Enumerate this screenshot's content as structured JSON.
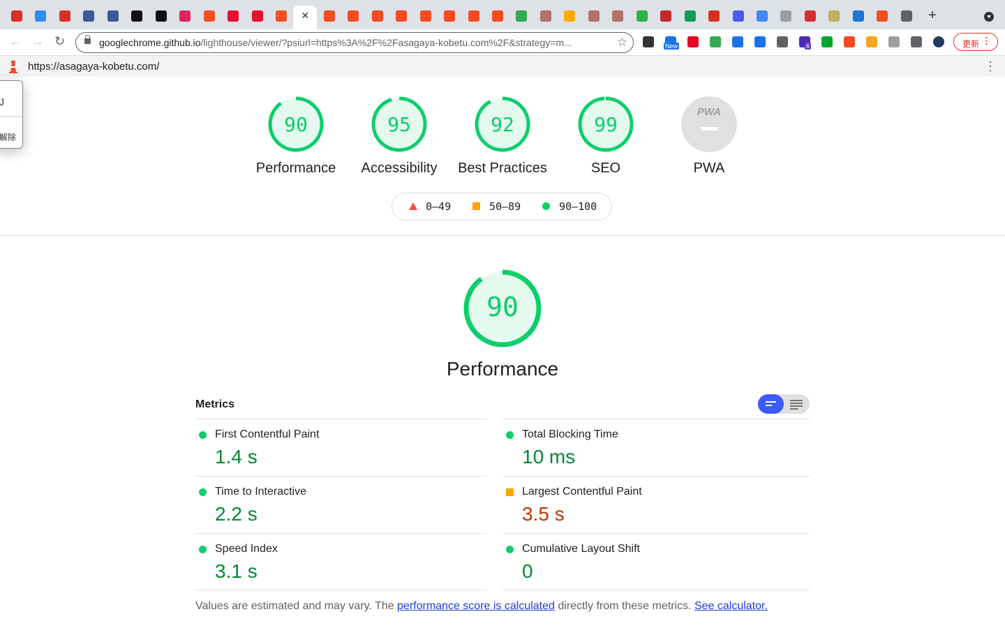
{
  "browser": {
    "tabs": [
      {
        "icon": "gmail-icon",
        "color": "#d93025"
      },
      {
        "icon": "zoom-icon",
        "color": "#2d8cff"
      },
      {
        "icon": "gmail-icon",
        "color": "#d93025"
      },
      {
        "icon": "z-icon",
        "color": "#3b5998"
      },
      {
        "icon": "z-icon",
        "color": "#3b5998"
      },
      {
        "icon": "triangle-icon",
        "color": "#111111"
      },
      {
        "icon": "triangle-icon",
        "color": "#111111"
      },
      {
        "icon": "flower-icon",
        "color": "#e0245e"
      },
      {
        "icon": "microsoft-icon",
        "color": "#f25022"
      },
      {
        "icon": "q-icon",
        "color": "#e8112d"
      },
      {
        "icon": "q-icon",
        "color": "#e8112d"
      },
      {
        "icon": "microsoft-icon",
        "color": "#f25022"
      },
      {
        "icon": "lighthouse-icon",
        "color": "#f44b21",
        "active": true
      },
      {
        "icon": "lighthouse-icon",
        "color": "#f44b21"
      },
      {
        "icon": "lighthouse-icon",
        "color": "#f44b21"
      },
      {
        "icon": "lighthouse-icon",
        "color": "#f44b21"
      },
      {
        "icon": "lighthouse-icon",
        "color": "#f44b21"
      },
      {
        "icon": "lighthouse-icon",
        "color": "#f44b21"
      },
      {
        "icon": "lighthouse-icon",
        "color": "#f44b21"
      },
      {
        "icon": "lighthouse-icon",
        "color": "#f44b21"
      },
      {
        "icon": "lighthouse-icon",
        "color": "#f44b21"
      },
      {
        "icon": "chart-icon",
        "color": "#34a853"
      },
      {
        "icon": "cards-icon",
        "color": "#b0726a"
      },
      {
        "icon": "analytics-icon",
        "color": "#f9ab00"
      },
      {
        "icon": "cards-icon",
        "color": "#b0726a"
      },
      {
        "icon": "cards-icon",
        "color": "#b0726a"
      },
      {
        "icon": "feedly-icon",
        "color": "#2bb24c"
      },
      {
        "icon": "globe-icon",
        "color": "#c62828"
      },
      {
        "icon": "ai-icon",
        "color": "#0f9d58"
      },
      {
        "icon": "gmail-icon",
        "color": "#d93025"
      },
      {
        "icon": "people-icon",
        "color": "#4a5cf0"
      },
      {
        "icon": "google-icon",
        "color": "#4285f4"
      },
      {
        "icon": "globe-icon",
        "color": "#9e9e9e"
      },
      {
        "icon": "map-pin-icon",
        "color": "#d32f2f"
      },
      {
        "icon": "photo-icon",
        "color": "#c0b060"
      },
      {
        "icon": "sheets-icon",
        "color": "#1976d2"
      },
      {
        "icon": "lighthouse-icon",
        "color": "#f44b21"
      },
      {
        "icon": "incognito-icon",
        "color": "#5f6368"
      }
    ],
    "close_tab_glyph": "✕",
    "new_tab_glyph": "+",
    "url_host": "googlechrome.github.io",
    "url_rest": "/lighthouse/viewer/?psiurl=https%3A%2F%2Fasagaya-kobetu.com%2F&strategy=m...",
    "extensions": [
      {
        "icon": "shoe-icon",
        "color": "#333333"
      },
      {
        "icon": "new-badge-icon",
        "color": "#1a73e8",
        "badge": "New"
      },
      {
        "icon": "pinterest-icon",
        "color": "#e60023"
      },
      {
        "icon": "google-icon",
        "color": "#34a853"
      },
      {
        "icon": "bi-icon",
        "color": "#1a73e8"
      },
      {
        "icon": "calendar-icon",
        "color": "#1a73e8"
      },
      {
        "icon": "r-icon",
        "color": "#5f6368"
      },
      {
        "icon": "hexagon-icon",
        "color": "#4b2bb3",
        "badge": "6"
      },
      {
        "icon": "evernote-icon",
        "color": "#00a82d"
      },
      {
        "icon": "lighthouse-icon",
        "color": "#f44b21"
      },
      {
        "icon": "tool-icon",
        "color": "#f5a623"
      },
      {
        "icon": "grey-box-icon",
        "color": "#9e9e9e"
      },
      {
        "icon": "puzzle-icon",
        "color": "#5f6368"
      },
      {
        "icon": "avatar-icon",
        "color": "#1f3a60"
      }
    ],
    "update_label": "更新",
    "menu_glyph": "⋮"
  },
  "lighthouse_bar": {
    "url": "https://asagaya-kobetu.com/",
    "menu_glyph": "⋮"
  },
  "popup": {
    "line1": "J",
    "line2": "解除"
  },
  "gauges": [
    {
      "label": "Performance",
      "score": 90
    },
    {
      "label": "Accessibility",
      "score": 95
    },
    {
      "label": "Best Practices",
      "score": 92
    },
    {
      "label": "SEO",
      "score": 99
    },
    {
      "label": "PWA",
      "badge": "PWA"
    }
  ],
  "legend": {
    "fail": "0–49",
    "average": "50–89",
    "pass": "90–100"
  },
  "colors": {
    "pass": "#0cce6b",
    "pass_text": "#008a30",
    "average": "#ffa400",
    "average_text": "#c33300",
    "fail": "#ff4e42",
    "toggle_active": "#3b5bfd"
  },
  "performance": {
    "score": 90,
    "title": "Performance"
  },
  "metrics": {
    "title": "Metrics",
    "left": [
      {
        "label": "First Contentful Paint",
        "value": "1.4 s",
        "rating": "pass"
      },
      {
        "label": "Time to Interactive",
        "value": "2.2 s",
        "rating": "pass"
      },
      {
        "label": "Speed Index",
        "value": "3.1 s",
        "rating": "pass"
      }
    ],
    "right": [
      {
        "label": "Total Blocking Time",
        "value": "10 ms",
        "rating": "pass"
      },
      {
        "label": "Largest Contentful Paint",
        "value": "3.5 s",
        "rating": "average"
      },
      {
        "label": "Cumulative Layout Shift",
        "value": "0",
        "rating": "pass"
      }
    ]
  },
  "footnote": {
    "prefix": "Values are estimated and may vary. The ",
    "link1": "performance score is calculated",
    "middle": " directly from these metrics. ",
    "link2": "See calculator."
  }
}
